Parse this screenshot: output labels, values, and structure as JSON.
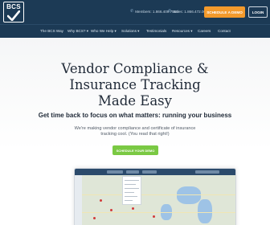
{
  "header": {
    "logo_text": "BCS",
    "phone_members": "Members: 1.866.409.7550",
    "phone_sales": "Sales: 1.866.472.0090",
    "schedule_label": "SCHEDULE A DEMO",
    "login_label": "LOGIN"
  },
  "nav": {
    "items": [
      {
        "label": "The BCS Way"
      },
      {
        "label": "Why BCS? ▾"
      },
      {
        "label": "Who We Help ▾"
      },
      {
        "label": "Solutions ▾"
      },
      {
        "label": "Testimonials"
      },
      {
        "label": "Resources ▾"
      },
      {
        "label": "Careers"
      },
      {
        "label": "Contact"
      }
    ]
  },
  "hero": {
    "title_lines": [
      "Vendor Compliance &",
      "Insurance Tracking",
      "Made Easy"
    ],
    "subtitle": "Get time back to focus on what matters: running your business",
    "description_lines": [
      "We're making vendor compliance and certificate of insurance",
      "tracking cool. (You read that right!)"
    ],
    "demo_button": "SCHEDULE YOUR DEMO"
  },
  "colors": {
    "header_bg": "#1c3a55",
    "accent_orange": "#f39a2c",
    "accent_green": "#7ac943",
    "heading_text": "#1f2937"
  },
  "icons": {
    "phone": "phone-icon",
    "logo_check": "checkmark-icon"
  }
}
